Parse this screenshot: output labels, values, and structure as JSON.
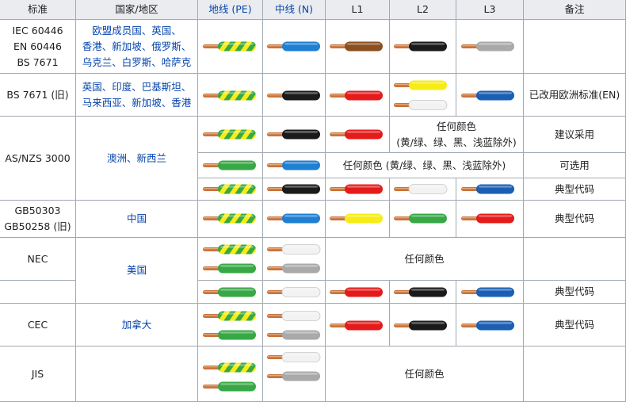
{
  "headers": {
    "standard": "标准",
    "region": "国家/地区",
    "earth": "地线 (PE)",
    "neutral": "中线 (N)",
    "l1": "L1",
    "l2": "L2",
    "l3": "L3",
    "notes": "备注"
  },
  "colors": {
    "header_bg": "#eaecf0",
    "border": "#a2a9b1",
    "link": "#0645ad",
    "copper": "#c6743f",
    "green": "#37a845",
    "yellow": "#f6ec16",
    "blue": "#1f7fd1",
    "black": "#1a1a1a",
    "brown": "#8a5020",
    "grey": "#a9a9a9",
    "white": "#f2f2f2",
    "red": "#e51b1b",
    "dark_blue": "#1a5fb4"
  },
  "rows": {
    "iec": {
      "standard": [
        "IEC 60446",
        "EN 60446",
        "BS 7671"
      ],
      "region": [
        "欧盟成员国、英国、",
        "香港、新加坡、俄罗斯、",
        "乌克兰、白罗斯、哈萨克"
      ]
    },
    "bs_old": {
      "standard": "BS 7671 (旧)",
      "region": [
        "英国、印度、巴基斯坦、",
        "马来西亚、新加坡、香港"
      ],
      "note": "已改用欧洲标准(EN)"
    },
    "asnzs": {
      "standard": "AS/NZS 3000",
      "region": "澳洲、新西兰",
      "any_color_1": [
        "任何颜色",
        "(黄/绿、绿、黑、浅蓝除外)"
      ],
      "note_1": "建议采用",
      "any_color_2": "任何颜色 (黄/绿、绿、黑、浅蓝除外)",
      "note_2": "可选用",
      "note_3": "典型代码"
    },
    "gb": {
      "standard": [
        "GB50303",
        "GB50258 (旧)"
      ],
      "region": "中国",
      "note": "典型代码"
    },
    "nec": {
      "standard": "NEC",
      "region": "美国",
      "any_color": "任何颜色",
      "note": "典型代码"
    },
    "cec": {
      "standard": "CEC",
      "region": "加拿大",
      "note": "典型代码"
    },
    "jis": {
      "standard": "JIS",
      "any_color": "任何颜色"
    }
  }
}
